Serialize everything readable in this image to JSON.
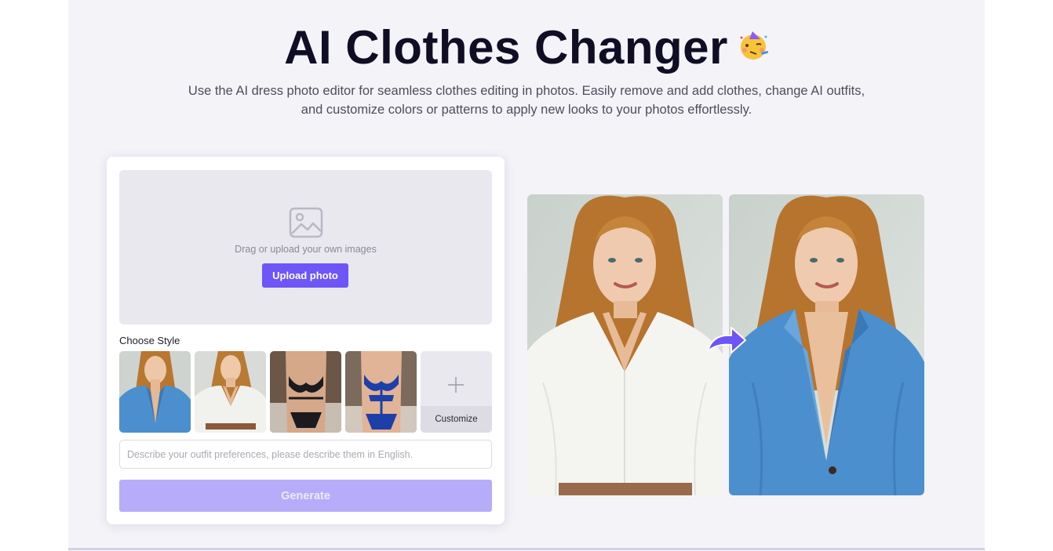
{
  "hero": {
    "title": "AI Clothes Changer",
    "emoji_icon": "party-face-emoji-icon",
    "subtitle_line1": "Use the AI dress photo editor for seamless clothes editing in photos. Easily remove and add clothes, change AI outfits,",
    "subtitle_line2": "and customize colors or patterns to apply new looks to your photos effortlessly."
  },
  "uploader": {
    "icon": "image-icon",
    "drop_text": "Drag or upload your own images",
    "upload_label": "Upload photo"
  },
  "styles": {
    "label": "Choose Style",
    "items": [
      {
        "name": "blue-blazer",
        "garment_color": "#4b8fcf"
      },
      {
        "name": "white-shirt",
        "garment_color": "#f1f1ee"
      },
      {
        "name": "black-lace",
        "garment_color": "#1b1b1f"
      },
      {
        "name": "blue-lace",
        "garment_color": "#1f3fa8"
      }
    ],
    "customize_label": "Customize",
    "customize_icon": "plus-icon"
  },
  "prompt": {
    "placeholder": "Describe your outfit preferences, please describe them in English.",
    "value": ""
  },
  "generate": {
    "label": "Generate"
  },
  "preview": {
    "arrow_icon": "curved-arrow-icon"
  },
  "colors": {
    "accent": "#6d55f7",
    "accent_disabled": "#b6acf9",
    "page_bg": "#f4f3f8",
    "title": "#0f0e25"
  }
}
